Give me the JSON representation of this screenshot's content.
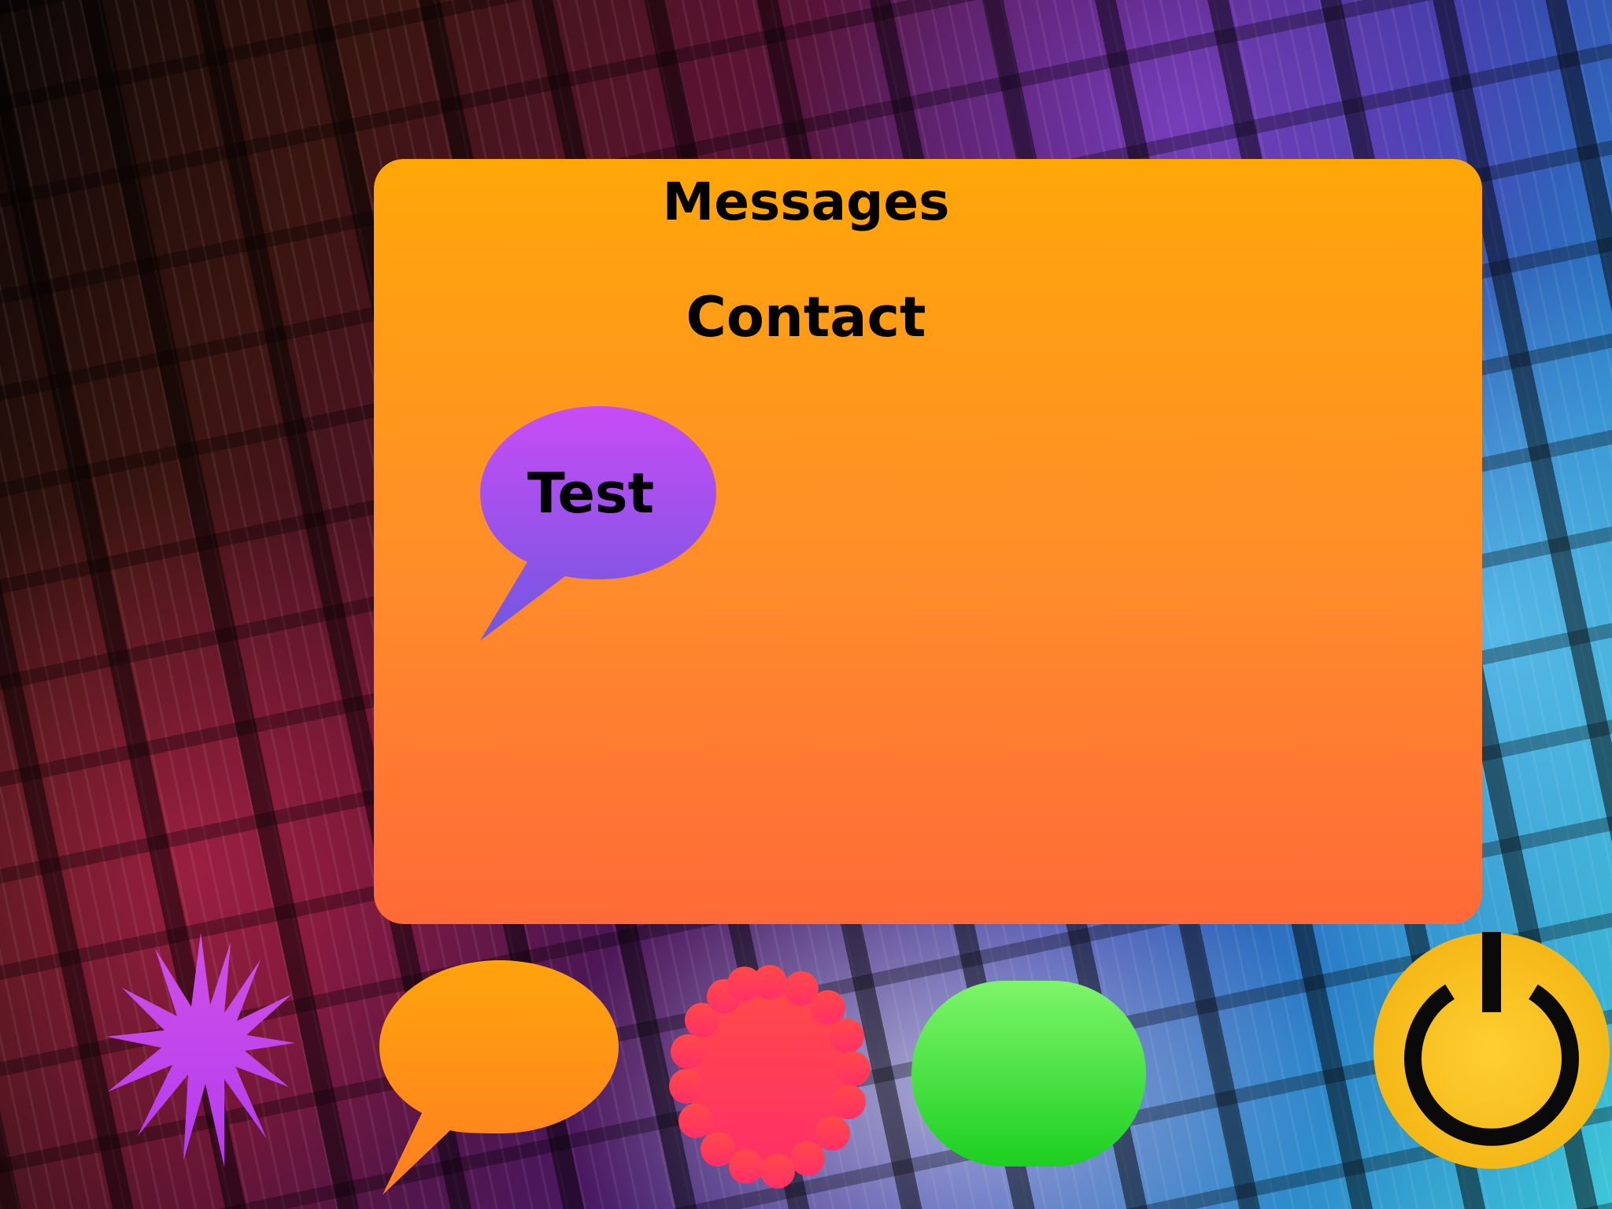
{
  "panel": {
    "title": "Messages",
    "subtitle": "Contact",
    "message_bubble": {
      "label": "Test"
    }
  },
  "dock": {
    "items": [
      {
        "icon": "starburst-icon",
        "color": "#c850e8"
      },
      {
        "icon": "speech-bubble-icon",
        "color": "#ff9a10"
      },
      {
        "icon": "flower-icon",
        "color": "#ff3a5a"
      },
      {
        "icon": "green-pill-icon",
        "color": "#3ee63e"
      },
      {
        "icon": "power-icon",
        "color": "#ffc82a"
      }
    ]
  },
  "colors": {
    "panel_top": "#ffa708",
    "panel_bottom": "#ff6a38",
    "bubble_top": "#c84cf5",
    "bubble_bottom": "#7a55e0"
  }
}
